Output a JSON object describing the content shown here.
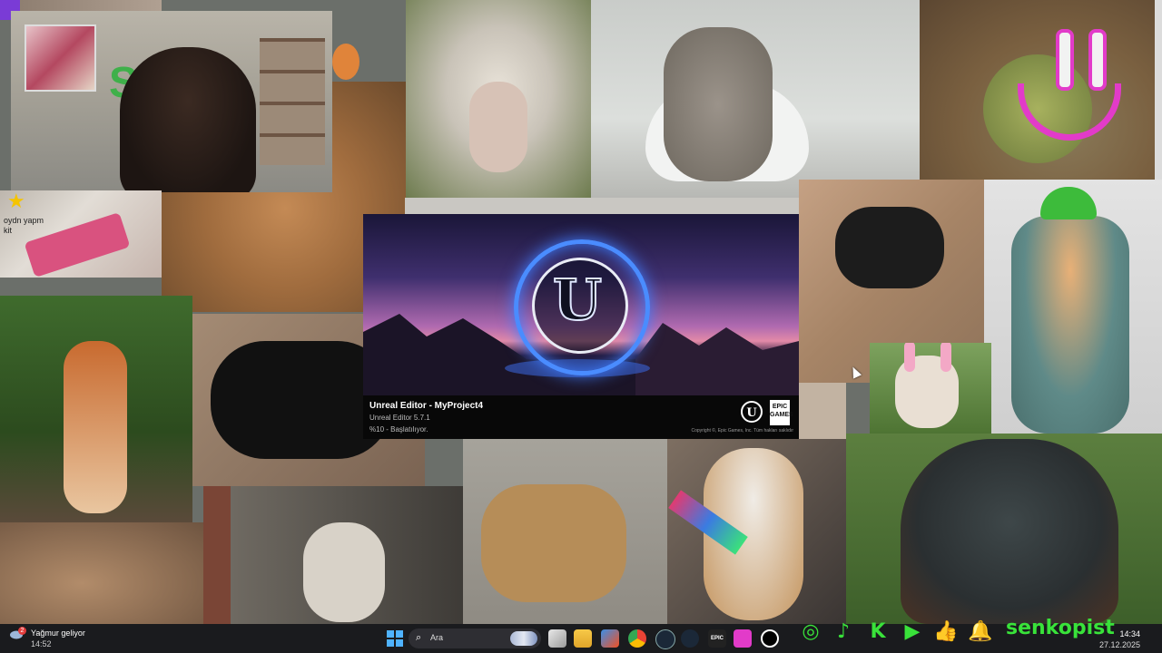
{
  "collage": {
    "star_caption": "oydn yapm\nkit",
    "colors": {
      "frog_face": "#e23bc9",
      "social_green": "#39e23a",
      "ue_ring": "#4a8cff"
    }
  },
  "splash": {
    "title": "Unreal Editor - MyProject4",
    "version": "Unreal Editor 5.7.1",
    "status": "%10 - Başlatılıyor.",
    "copyright": "Copyright ©, Epic Games, Inc. Tüm hakları saklıdır",
    "logo_letter": "U",
    "epic_label": "EPIC\nGAMES"
  },
  "taskbar": {
    "weather": {
      "badge": "2",
      "line1": "Yağmur geliyor",
      "line2": "14:52"
    },
    "search": {
      "placeholder": "Ara"
    },
    "apps": [
      "start-icon",
      "search",
      "task-view-icon",
      "file-explorer-icon",
      "store-icon",
      "chrome-icon",
      "steam-alt-icon",
      "steam-icon",
      "epic-icon",
      "pink-app-icon",
      "unreal-icon"
    ],
    "clock": {
      "time": "14:34",
      "date": "27.12.2025"
    }
  },
  "social": {
    "icons": [
      "instagram-icon",
      "tiktok-icon",
      "kick-icon",
      "youtube-icon",
      "thumbs-up-icon",
      "bell-icon"
    ],
    "glyphs": [
      "◎",
      "♪",
      "K",
      "▶",
      "👍",
      "🔔"
    ],
    "handle": "senkopist"
  }
}
